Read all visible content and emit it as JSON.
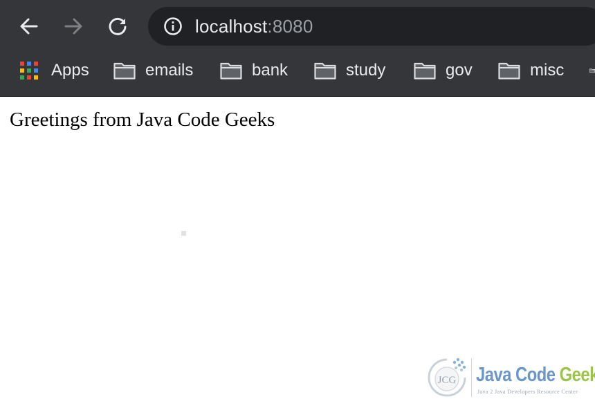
{
  "toolbar": {
    "back_icon": "arrow-left-icon",
    "forward_icon": "arrow-right-icon",
    "reload_icon": "reload-icon",
    "site_info_icon": "info-icon",
    "url_host": "localhost",
    "url_port": ":8080"
  },
  "bookmarks": {
    "items": [
      {
        "label": "Apps",
        "icon": "apps-grid-icon"
      },
      {
        "label": "emails",
        "icon": "folder-icon"
      },
      {
        "label": "bank",
        "icon": "folder-icon"
      },
      {
        "label": "study",
        "icon": "folder-icon"
      },
      {
        "label": "gov",
        "icon": "folder-icon"
      },
      {
        "label": "misc",
        "icon": "folder-icon"
      }
    ]
  },
  "page": {
    "greeting": "Greetings from Java Code Geeks"
  },
  "watermark": {
    "title_java_code": "Java Code ",
    "title_geeks": "Geeks",
    "tagline": "Java 2 Java Developers Resource Center",
    "emblem_text": "JCG"
  },
  "colors": {
    "chrome_frame": "#35363a",
    "omnibox": "#202124",
    "url_text": "#e8eaed",
    "url_port": "#9aa0a6",
    "logo_blue": "#6a96c8",
    "logo_green": "#9cc44b"
  }
}
